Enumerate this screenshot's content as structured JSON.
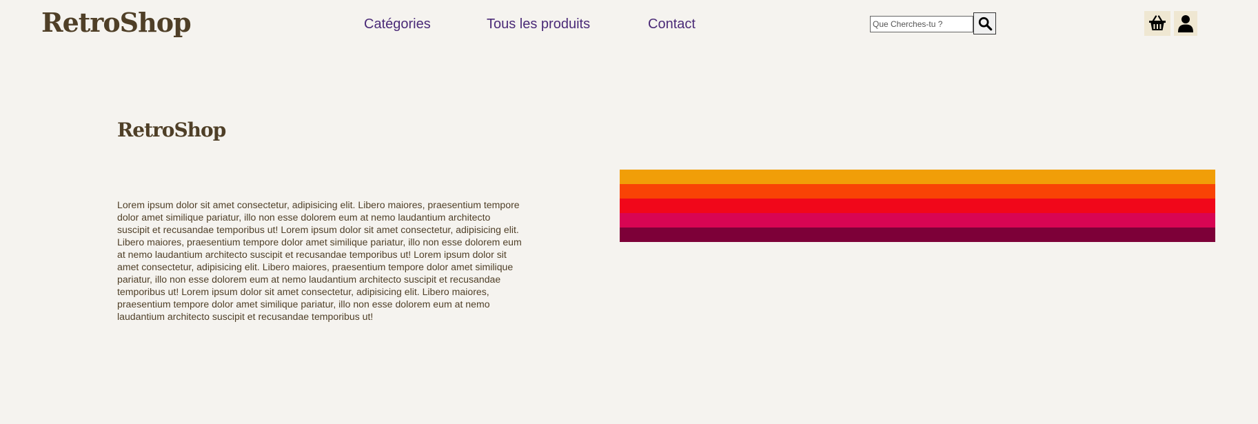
{
  "header": {
    "brand": "RetroShop",
    "nav": [
      {
        "label": "Catégories"
      },
      {
        "label": "Tous les produits"
      },
      {
        "label": "Contact"
      }
    ],
    "search": {
      "placeholder": "Que Cherches-tu ?",
      "value": "",
      "button_icon": "search-icon"
    },
    "icons": {
      "basket": "basket-icon",
      "user": "user-icon"
    }
  },
  "main": {
    "title": "RetroShop",
    "text": "Lorem ipsum dolor sit amet consectetur, adipisicing elit. Libero maiores, praesentium tempore dolor amet similique pariatur, illo non esse dolorem eum at nemo laudantium architecto suscipit et recusandae temporibus ut! Lorem ipsum dolor sit amet consectetur, adipisicing elit. Libero maiores, praesentium tempore dolor amet similique pariatur, illo non esse dolorem eum at nemo laudantium architecto suscipit et recusandae temporibus ut! Lorem ipsum dolor sit amet consectetur, adipisicing elit. Libero maiores, praesentium tempore dolor amet similique pariatur, illo non esse dolorem eum at nemo laudantium architecto suscipit et recusandae temporibus ut! Lorem ipsum dolor sit amet consectetur, adipisicing elit. Libero maiores, praesentium tempore dolor amet similique pariatur, illo non esse dolorem eum at nemo laudantium architecto suscipit et recusandae temporibus ut!",
    "stripe_colors": [
      "#f19e08",
      "#f94305",
      "#f1071a",
      "#d80553",
      "#7d0038"
    ]
  },
  "colors": {
    "background": "#f5f3ef",
    "brand_text": "#4f3f27",
    "nav_link": "#4a2a77",
    "icon_button_bg": "#efe7d2"
  }
}
